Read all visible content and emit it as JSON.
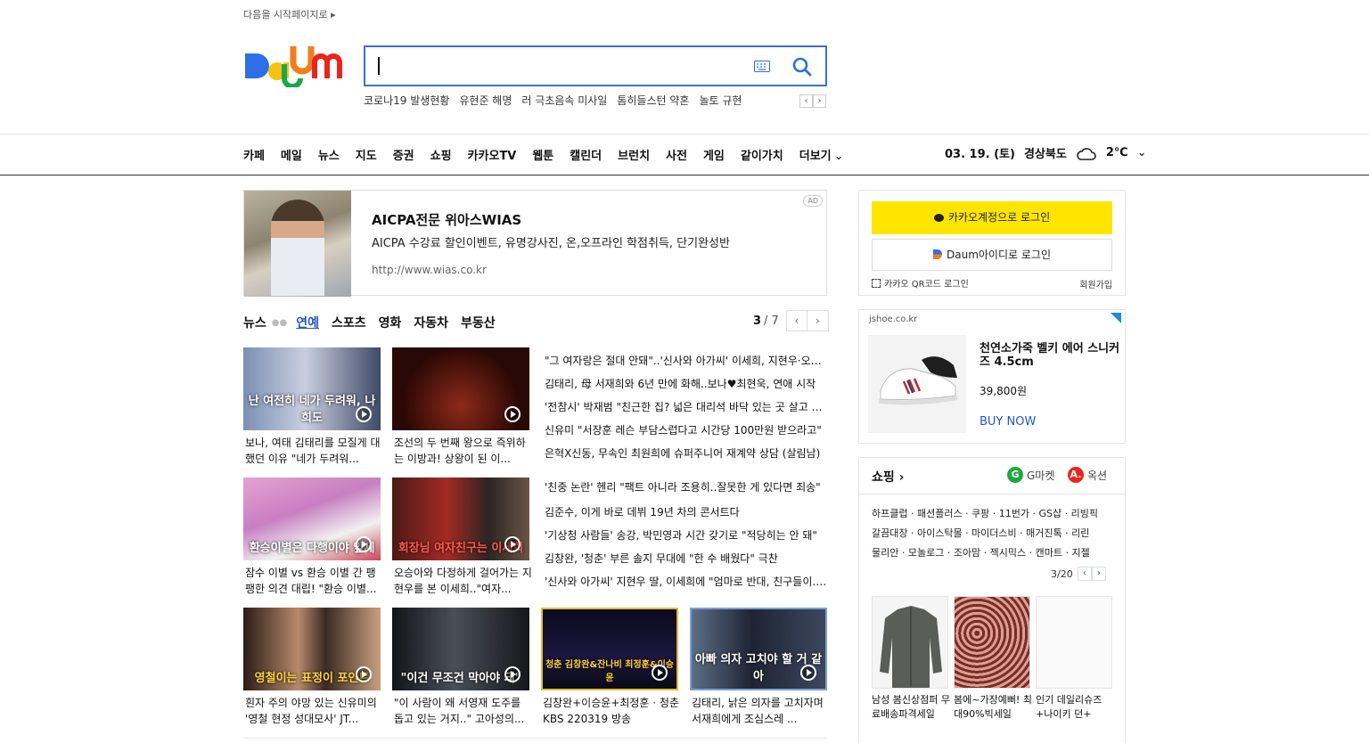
{
  "top": {
    "start_page": "다음을 시작페이지로 ▸"
  },
  "search": {
    "placeholder": ""
  },
  "trending": {
    "keywords": [
      "코로나19 발생현황",
      "유현준 해명",
      "러 극초음속 미사일",
      "톰히들스턴 약혼",
      "놀토 규현"
    ],
    "prev": "‹",
    "next": "›"
  },
  "gnb": {
    "items": [
      "카페",
      "메일",
      "뉴스",
      "지도",
      "증권",
      "쇼핑",
      "카카오TV",
      "웹툰",
      "캘린더",
      "브런치",
      "사전",
      "게임",
      "같이가치"
    ],
    "more": "더보기"
  },
  "weather": {
    "date": "03. 19. (토)",
    "region": "경상북도",
    "temp": "2℃",
    "icon": "cloud-icon"
  },
  "ad": {
    "title": "AICPA전문 위아스WIAS",
    "desc": "AICPA 수강료 할인이벤트, 유명강사진, 온,오프라인 학점취득, 단기완성반",
    "url": "http://www.wias.co.kr",
    "badge": "AD"
  },
  "news": {
    "tabs": [
      "뉴스",
      "연예",
      "스포츠",
      "영화",
      "자동차",
      "부동산"
    ],
    "active_tab": "연예",
    "page_current": "3",
    "page_total": "/ 7",
    "thumbs": [
      {
        "caption": "보나, 여태 김태리를 모질게 대했던 이유 \"네가 두려워...",
        "overlay": "난 여전히 네가 두려워, 나희도"
      },
      {
        "caption": "조선의 두 번째 왕으로 즉위하는 이방과! 상왕이 된 이...",
        "overlay": ""
      },
      {
        "caption": "잠수 이별 vs 환승 이별 간 팽팽한 의견 대립! \"환승 이별...",
        "overlay": "환승이별은 다행이야 앞세"
      },
      {
        "caption": "오승아와 다정하게 걸어가는 지현우를 본 이세희..\"여자...",
        "overlay": "회장님 여자친구는 이세희"
      },
      {
        "caption": "흰자 주의 야망 있는 신유미의 '영철 현정 성대모사' JT...",
        "overlay": "영철이는 표정이 포인트"
      },
      {
        "caption": "\"이 사람이 왜 서영재 도주를 돕고 있는 거지..\" 고아성의...",
        "overlay": "\"이건 무조건 막아야 돼\""
      },
      {
        "caption": "김창완+이승윤+최정훈 · 청춘 KBS 220319 방송",
        "overlay": "청춘 김창완&잔나비 최정훈&이승윤"
      },
      {
        "caption": "김태리, 낡은 의자를 고치자며 서재희에게 조심스레 ...",
        "overlay": "아빠 의자 고치야 할 거 같아"
      }
    ],
    "headlines": [
      "\"그 여자랑은 절대 안돼\"..'신사와 아가씨' 이세희, 지현우·오승아 교제 반대",
      "김태리, 母 서재희와 6년 만에 화해..보나♥최현욱, 연애 시작",
      "'전참시' 박재범 \"친근한 집? 넓은 대리석 바닥 있는 곳 살고 싶어\"",
      "신유미 \"서장훈 레슨 부담스럽다고 시간당 100만원 받으라고\"",
      "은혁X신동, 무속인 최원희에 슈퍼주니어 재계약 상담 (살림남)",
      "'친중 논란' 헨리 \"팩트 아니라 조용히..잘못한 게 있다면 죄송\"",
      "김준수, 이게 바로 데뷔 19년 차의 콘서트다",
      "'기상청 사람들' 송강, 박민영과 시간 갖기로 \"적당히는 안 돼\"",
      "김창완, '청춘' 부른 솔지 무대에 \"한 수 배웠다\" 극찬",
      "'신사와 아가씨' 지현우 딸, 이세희에 \"엄마로 반대, 친구들이...\""
    ]
  },
  "login": {
    "kakao": "카카오계정으로 로그인",
    "daum": "Daum아이디로 로그인",
    "qr": "카카오 QR코드 로그인",
    "join": "회원가입"
  },
  "shoe_ad": {
    "domain": "jshoe.co.kr",
    "name": "천연소가죽 벨키 에어 스니커즈 4.5cm",
    "price": "39,800원",
    "cta": "BUY NOW"
  },
  "shopping": {
    "title": "쇼핑",
    "gmarket": "G마켓",
    "auction": "옥션",
    "links": [
      "하프클럽 · 패션플러스 · 쿠팡 · 11번가 · GS샵 · 리빙픽",
      "갈끔대장 · 아이스탁몰 · 마이더스비 · 매거진톡 · 리린",
      "물리안 · 모놀로그 · 조아맘 · 젝시믹스 · 캔마트 · 지젤"
    ],
    "page": "3/20",
    "products": [
      {
        "caption": "남성 봄신상점퍼 무료배송파격세일"
      },
      {
        "caption": "봄에~가장예뻐! 최대90%빅세일"
      },
      {
        "caption": "인기 데일리슈즈 +나이키 던+"
      }
    ]
  },
  "colors": {
    "accent": "#2356c8",
    "search_border": "#3b6ee6",
    "kakao": "#fee500"
  }
}
